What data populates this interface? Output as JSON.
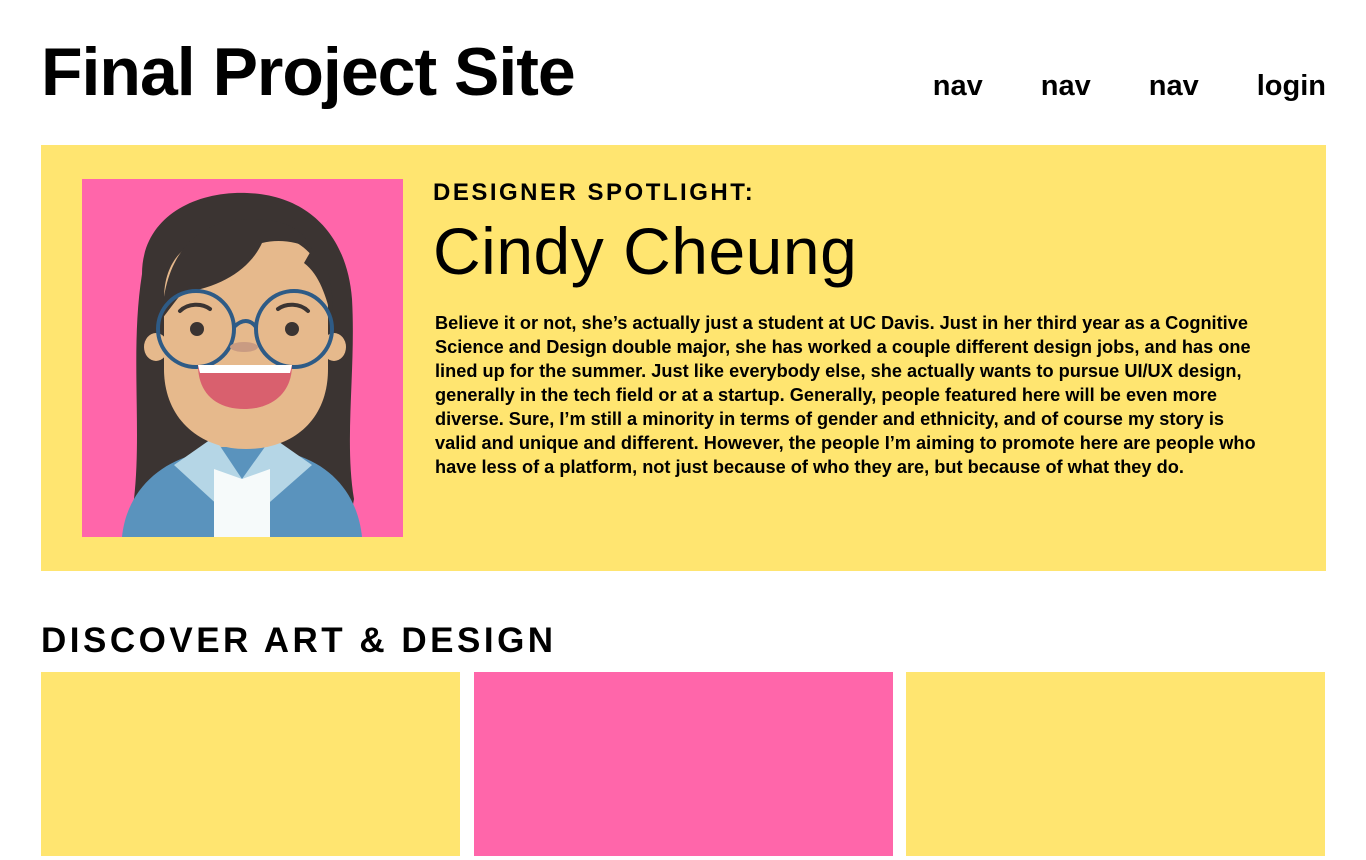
{
  "header": {
    "site_title": "Final Project Site",
    "nav_items": [
      "nav",
      "nav",
      "nav"
    ],
    "login_label": "login"
  },
  "spotlight": {
    "label": "DESIGNER SPOTLIGHT:",
    "name": "Cindy Cheung",
    "bio": "Believe it or not, she’s actually just a student at UC Davis. Just in her third year as a Cognitive Science and Design double major, she has worked a couple different design jobs, and has one lined up for the summer. Just like everybody else, she actually wants to pursue UI/UX design, generally in the tech field or at a startup. Generally, people featured here will be even more diverse. Sure, I’m still a minority in terms of gender and ethnicity, and of course my story is valid and unique and different. However, the people I’m aiming to promote here are people who have less of a platform, not just because of who they are, but because of what they do.",
    "avatar_icon": "avatar-illustration"
  },
  "discover": {
    "heading": "DISCOVER ART & DESIGN",
    "cards": [
      {
        "color": "#FFE570"
      },
      {
        "color": "#FF66AA"
      },
      {
        "color": "#FFE570"
      }
    ]
  },
  "colors": {
    "yellow": "#FFE570",
    "pink": "#FF66AA",
    "text": "#000000",
    "background": "#FFFFFF"
  }
}
